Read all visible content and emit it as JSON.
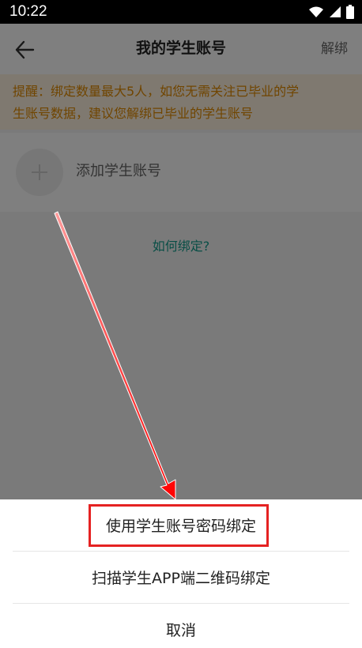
{
  "status_bar": {
    "time": "10:22"
  },
  "app_bar": {
    "title": "我的学生账号",
    "unbind": "解绑"
  },
  "notice": {
    "line1": "提醒：绑定数量最大5人，如您无需关注已毕业的学",
    "line2": "生账号数据，建议您解绑已毕业的学生账号"
  },
  "add_student": {
    "label": "添加学生账号"
  },
  "help": {
    "label": "如何绑定?"
  },
  "action_sheet": {
    "options": [
      {
        "label": "使用学生账号密码绑定"
      },
      {
        "label": "扫描学生APP端二维码绑定"
      },
      {
        "label": "取消"
      }
    ]
  },
  "colors": {
    "notice_text": "#e18a00",
    "help_link": "#129c8c",
    "highlight": "#e52222"
  },
  "icons": {
    "back": "back-arrow-icon",
    "add": "plus-icon",
    "wifi": "wifi-icon",
    "signal": "signal-icon",
    "battery": "battery-icon"
  }
}
